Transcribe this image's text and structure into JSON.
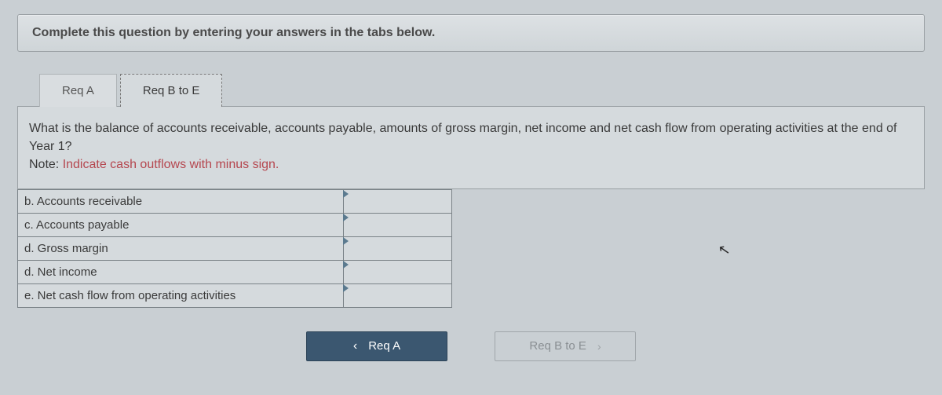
{
  "instruction": "Complete this question by entering your answers in the tabs below.",
  "tabs": {
    "reqA": "Req A",
    "reqBE": "Req B to E"
  },
  "question": {
    "text": "What is the balance of accounts receivable, accounts payable, amounts of gross margin, net income and net cash flow from operating activities at the end of Year 1?",
    "notePrefix": "Note: ",
    "noteBody": "Indicate cash outflows with minus sign."
  },
  "rows": [
    {
      "label": "b. Accounts receivable",
      "value": ""
    },
    {
      "label": "c. Accounts payable",
      "value": ""
    },
    {
      "label": "d. Gross margin",
      "value": ""
    },
    {
      "label": "d. Net income",
      "value": ""
    },
    {
      "label": "e. Net cash flow from operating activities",
      "value": ""
    }
  ],
  "nav": {
    "prev": "Req A",
    "next": "Req B to E"
  }
}
